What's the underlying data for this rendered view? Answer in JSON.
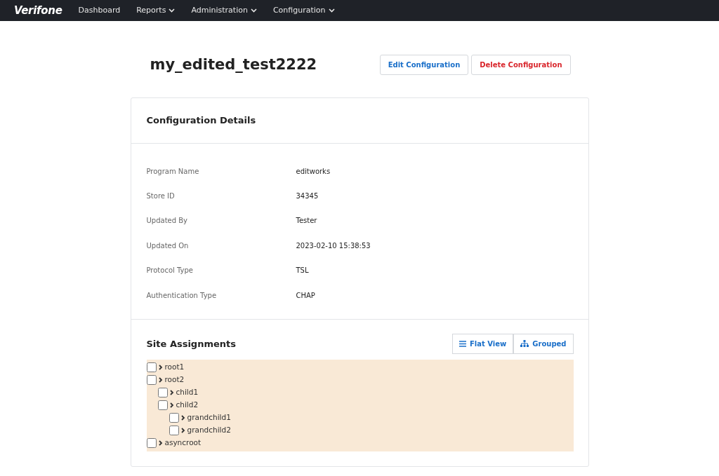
{
  "navbar": {
    "brand": "Verifone",
    "items": [
      {
        "label": "Dashboard",
        "dropdown": false
      },
      {
        "label": "Reports",
        "dropdown": true
      },
      {
        "label": "Administration",
        "dropdown": true
      },
      {
        "label": "Configuration",
        "dropdown": true
      }
    ]
  },
  "title": "my_edited_test2222",
  "actions": [
    {
      "label": "Edit Configuration",
      "kind": "primary"
    },
    {
      "label": "Delete Configuration",
      "kind": "danger"
    }
  ],
  "details": {
    "title": "Configuration Details",
    "fields": [
      {
        "label": "Program Name",
        "value": "editworks"
      },
      {
        "label": "Store ID",
        "value": "34345"
      },
      {
        "label": "Updated By",
        "value": "Tester"
      },
      {
        "label": "Updated On",
        "value": "2023-02-10 15:38:53"
      },
      {
        "label": "Protocol Type",
        "value": "TSL"
      },
      {
        "label": "Authentication Type",
        "value": "CHAP"
      }
    ]
  },
  "site_assignments": {
    "title": "Site Assignments",
    "views": [
      {
        "label": "Flat View",
        "kind": "flat"
      },
      {
        "label": "Grouped",
        "kind": "grouped"
      }
    ],
    "tree": [
      {
        "label": "root1",
        "checked": false
      },
      {
        "label": "root2",
        "checked": false,
        "children": [
          {
            "label": "child1",
            "checked": false
          },
          {
            "label": "child2",
            "checked": false,
            "children": [
              {
                "label": "grandchild1",
                "checked": false
              },
              {
                "label": "grandchild2",
                "checked": false
              }
            ]
          }
        ]
      },
      {
        "label": "asyncroot",
        "checked": false
      }
    ]
  }
}
